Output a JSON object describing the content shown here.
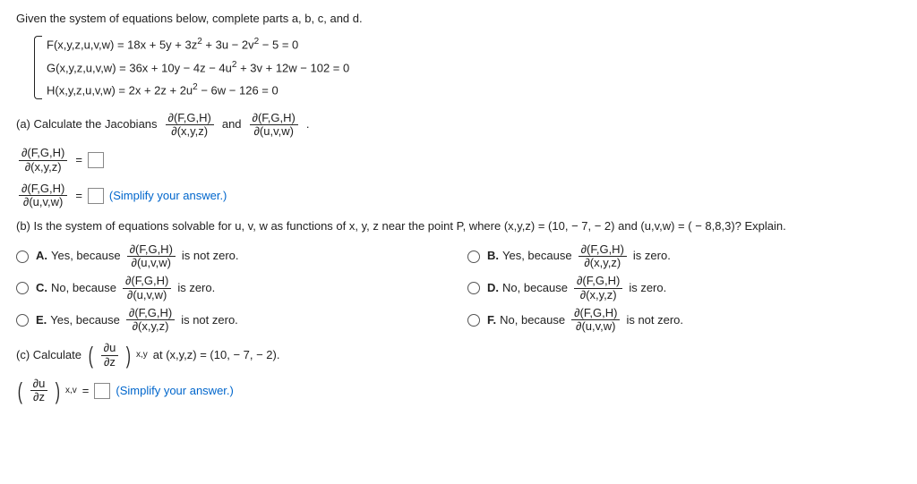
{
  "intro": "Given the system of equations below, complete parts a, b, c, and d.",
  "system": {
    "eq1": "F(x,y,z,u,v,w) = 18x + 5y + 3z² + 3u − 2v² − 5 = 0",
    "eq2": "G(x,y,z,u,v,w) = 36x + 10y − 4z − 4u² + 3v + 12w − 102 = 0",
    "eq3": "H(x,y,z,u,v,w) = 2x + 2z + 2u² − 6w − 126 = 0"
  },
  "jac": {
    "num": "∂(F,G,H)",
    "dxyz": "∂(x,y,z)",
    "duvw": "∂(u,v,w)"
  },
  "partA": {
    "lead": "(a) Calculate the Jacobians",
    "and": "and",
    "dot": "."
  },
  "eqsym": "=",
  "simplify": "(Simplify your answer.)",
  "partB": {
    "q": "(b) Is the system of equations solvable for u, v, w as functions of x, y, z near the point P, where (x,y,z) = (10, − 7, − 2) and (u,v,w) = ( − 8,8,3)? Explain.",
    "opts": {
      "A": {
        "l": "A.",
        "pre": "Yes, because",
        "tail": "is not zero."
      },
      "B": {
        "l": "B.",
        "pre": "Yes, because",
        "tail": "is zero."
      },
      "C": {
        "l": "C.",
        "pre": "No, because",
        "tail": "is zero."
      },
      "D": {
        "l": "D.",
        "pre": "No, because",
        "tail": "is zero."
      },
      "E": {
        "l": "E.",
        "pre": "Yes, because",
        "tail": "is not zero."
      },
      "F": {
        "l": "F.",
        "pre": "No, because",
        "tail": "is not zero."
      }
    }
  },
  "partC": {
    "lead": "(c) Calculate",
    "du": "∂u",
    "dz": "∂z",
    "sub": "x,y",
    "tail": "at (x,y,z) = (10, − 7, − 2).",
    "sub2": "x,v"
  }
}
